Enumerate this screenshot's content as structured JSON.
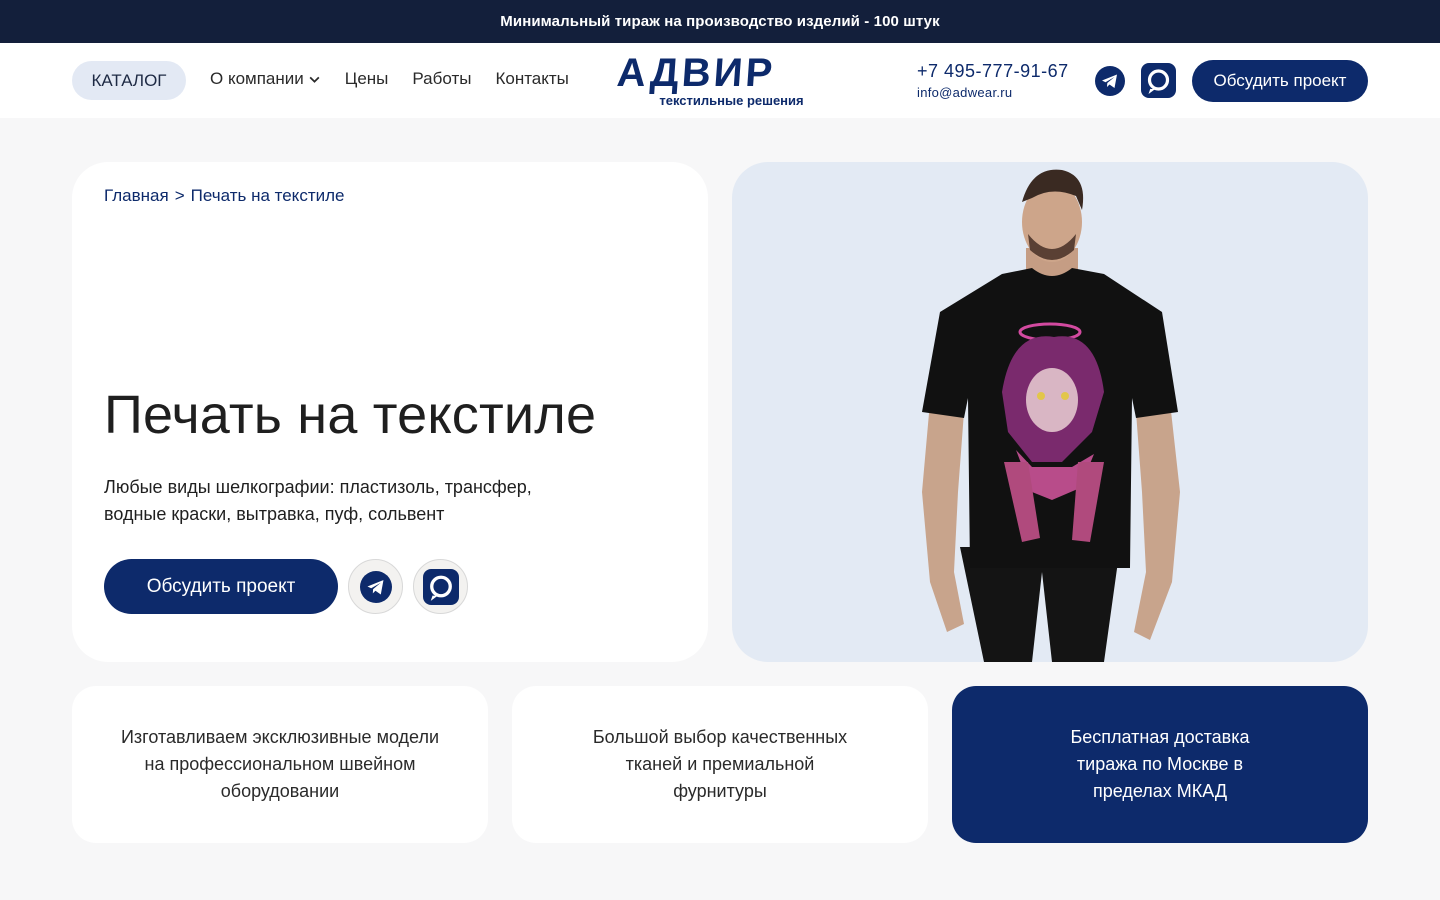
{
  "topbar": {
    "text": "Минимальный тираж на производство изделий - 100 штук"
  },
  "header": {
    "catalog_label": "КАТАЛОГ",
    "nav": [
      {
        "label": "О компании",
        "has_dropdown": true
      },
      {
        "label": "Цены"
      },
      {
        "label": "Работы"
      },
      {
        "label": "Контакты"
      }
    ],
    "logo": {
      "brand": "АДВИР",
      "tagline": "текстильные решения"
    },
    "phone": "+7 495-777-91-67",
    "email": "info@adwear.ru",
    "cta_label": "Обсудить проект",
    "icons": [
      "telegram-icon",
      "max-messenger-icon"
    ]
  },
  "hero": {
    "breadcrumb": {
      "home": "Главная",
      "separator": ">",
      "current": "Печать на текстиле"
    },
    "title": "Печать на текстиле",
    "description": "Любые виды шелкографии: пластизоль, трансфер, водные краски, вытравка, пуф, сольвент",
    "cta_label": "Обсудить проект"
  },
  "features": [
    {
      "text": "Изготавливаем эксклюзивные модели на профессиональном швейном оборудовании"
    },
    {
      "text": "Большой выбор качественных тканей и премиальной фурнитуры"
    },
    {
      "text": "Бесплатная доставка тиража по Москве в пределах МКАД"
    }
  ],
  "colors": {
    "brand_navy": "#0d2a6b",
    "topbar": "#131f3b",
    "page_bg": "#f7f7f8",
    "hero_image_bg": "#e3eaf4",
    "catalog_pill": "#e3e9f4"
  }
}
